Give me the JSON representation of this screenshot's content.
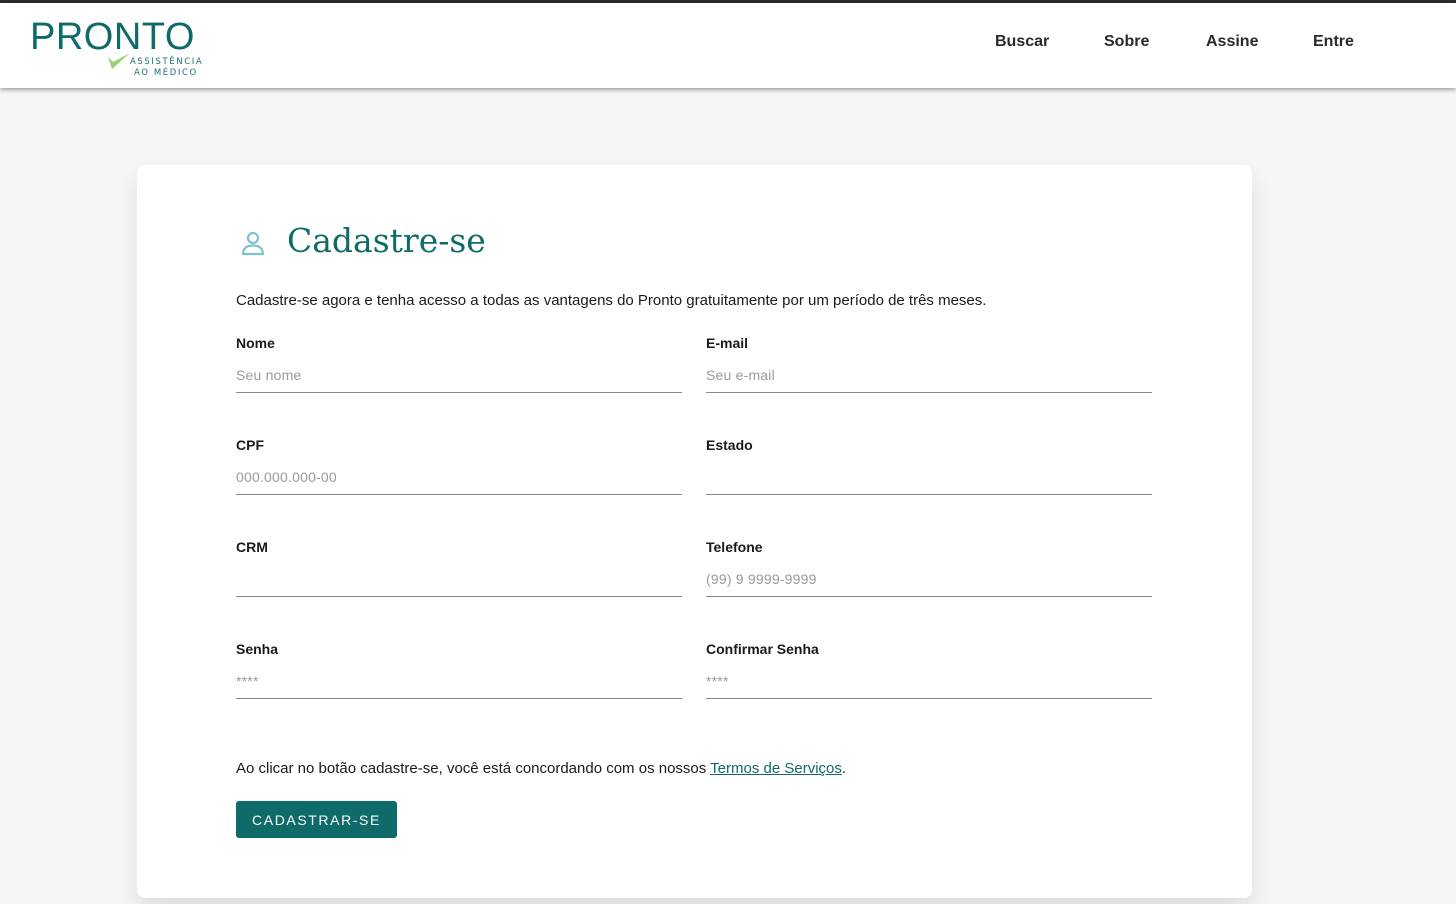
{
  "brand": {
    "name": "PRONTO",
    "tagline_line1": "ASSISTÊNCIA",
    "tagline_line2": "AO MÉDICO",
    "primary_color": "#0f6b6a",
    "check_color": "#9ccf6f"
  },
  "nav": {
    "items": [
      {
        "label": "Buscar"
      },
      {
        "label": "Sobre"
      },
      {
        "label": "Assine"
      },
      {
        "label": "Entre"
      }
    ]
  },
  "form": {
    "title": "Cadastre-se",
    "title_icon": "user-icon",
    "intro": "Cadastre-se agora e tenha acesso a todas as vantagens do Pronto gratuitamente por um período de três meses.",
    "fields": {
      "nome": {
        "label": "Nome",
        "placeholder": "Seu nome",
        "value": ""
      },
      "email": {
        "label": "E-mail",
        "placeholder": "Seu e-mail",
        "value": ""
      },
      "cpf": {
        "label": "CPF",
        "placeholder": "000.000.000-00",
        "value": ""
      },
      "estado": {
        "label": "Estado",
        "placeholder": "",
        "value": ""
      },
      "crm": {
        "label": "CRM",
        "placeholder": "",
        "value": ""
      },
      "telefone": {
        "label": "Telefone",
        "placeholder": "(99) 9 9999-9999",
        "value": ""
      },
      "senha": {
        "label": "Senha",
        "placeholder": "****",
        "value": ""
      },
      "confirmar_senha": {
        "label": "Confirmar Senha",
        "placeholder": "****",
        "value": ""
      }
    },
    "terms_prefix": "Ao clicar no botão cadastre-se, você está concordando com os nossos ",
    "terms_link": "Termos de Serviços",
    "terms_suffix": ".",
    "submit_label": "CADASTRAR-SE"
  }
}
